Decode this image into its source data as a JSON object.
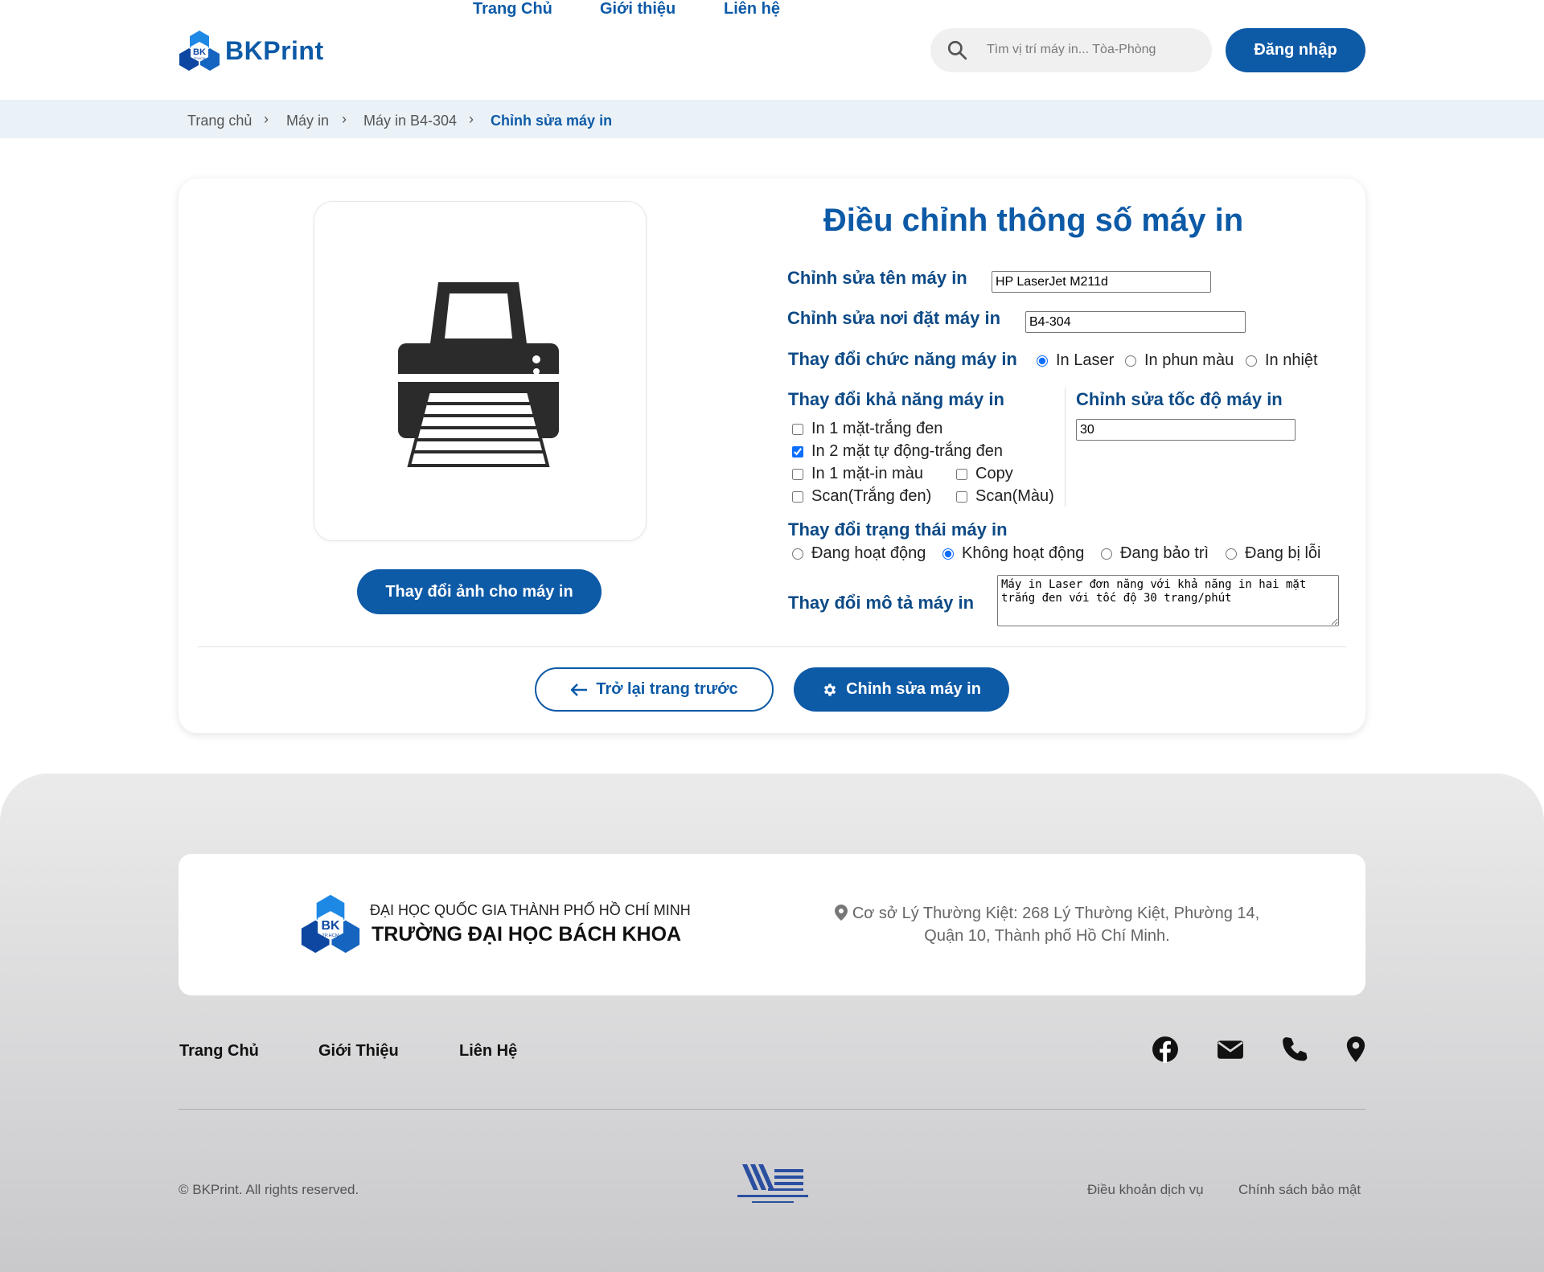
{
  "header": {
    "brand": "BKPrint",
    "nav": [
      "Trang Chủ",
      "Giới thiệu",
      "Liên hệ"
    ],
    "search_placeholder": "Tìm vị trí máy in... Tòa-Phòng",
    "login_label": "Đăng nhập"
  },
  "breadcrumb": [
    "Trang chủ",
    "Máy in",
    "Máy in B4-304",
    "Chỉnh sửa máy in"
  ],
  "left_panel": {
    "change_image_label": "Thay đổi ảnh cho máy in"
  },
  "form": {
    "title": "Điều chỉnh thông số máy in",
    "name_label": "Chỉnh sửa tên máy in",
    "name_value": "HP LaserJet M211d",
    "location_label": "Chỉnh sửa nơi đặt máy in",
    "location_value": "B4-304",
    "function_label": "Thay đổi chức năng máy in",
    "functions": [
      {
        "label": "In Laser",
        "checked": true
      },
      {
        "label": "In phun màu",
        "checked": false
      },
      {
        "label": "In nhiệt",
        "checked": false
      }
    ],
    "capability_label": "Thay đổi khả năng máy in",
    "capabilities": [
      {
        "label": "In 1 mặt-trắng đen",
        "checked": false
      },
      {
        "label": "In 2 mặt tự động-trắng đen",
        "checked": true
      },
      {
        "label": "In 1 mặt-in màu",
        "checked": false
      },
      {
        "label": "Copy",
        "checked": false
      },
      {
        "label": "Scan(Trắng đen)",
        "checked": false
      },
      {
        "label": "Scan(Màu)",
        "checked": false
      }
    ],
    "speed_label": "Chỉnh sửa tốc độ máy in",
    "speed_value": "30",
    "status_label": "Thay đổi trạng thái máy in",
    "statuses": [
      {
        "label": "Đang hoạt động",
        "checked": false
      },
      {
        "label": "Không hoạt động",
        "checked": true
      },
      {
        "label": "Đang bảo trì",
        "checked": false
      },
      {
        "label": "Đang bị lỗi",
        "checked": false
      }
    ],
    "description_label": "Thay đổi mô tả máy in",
    "description_value": "Máy in Laser đơn năng với khả năng in hai mặt trắng đen với tốc độ 30 trang/phút",
    "back_label": "Trở lại trang trước",
    "submit_label": "Chỉnh sửa máy in"
  },
  "footer": {
    "uni_line1": "ĐẠI HỌC QUỐC GIA THÀNH PHỐ HỒ CHÍ MINH",
    "uni_line2": "TRƯỜNG ĐẠI HỌC BÁCH KHOA",
    "address": "Cơ sở Lý Thường Kiệt: 268 Lý Thường Kiệt, Phường 14, Quận 10, Thành phố Hồ Chí Minh.",
    "links": [
      "Trang Chủ",
      "Giới Thiệu",
      "Liên Hệ"
    ],
    "social_icons": [
      "facebook-icon",
      "mail-icon",
      "phone-icon",
      "location-pin-icon"
    ],
    "copyright": "© BKPrint. All rights reserved.",
    "policies": [
      "Điều khoản dịch vụ",
      "Chính sách bảo mật"
    ]
  },
  "colors": {
    "primary": "#0d5aa7",
    "breadcrumb_bg": "#eaf2f8",
    "footer_bg": "#d9d9dc"
  }
}
